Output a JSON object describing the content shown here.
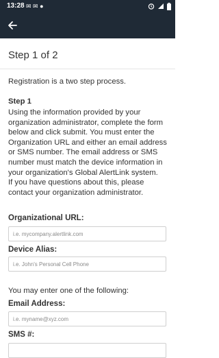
{
  "status_bar": {
    "time": "13:28",
    "notification_icons": "✉ ✉ ●"
  },
  "app_bar": {
    "back_icon": "arrow-left-icon"
  },
  "page": {
    "step_title": "Step 1 of 2",
    "intro": "Registration is a two step process.",
    "step1_heading": "Step 1",
    "instructions_lines": [
      "Using the information provided by your",
      "organization administrator, complete the form",
      "below and click submit. You must enter the",
      "Organization URL and either an email address",
      "or SMS number. The email address or SMS",
      "number must match the device information in",
      "your organization's Global AlertLink system.",
      "If you have questions about this, please",
      "contact your organization administrator."
    ]
  },
  "form": {
    "org_url_label": "Organizational URL:",
    "org_url_placeholder": "i.e. mycompany.alertlink.com",
    "device_alias_label": "Device Alias:",
    "device_alias_placeholder": "i.e. John's Personal Cell Phone",
    "enter_one": "You may enter one of the following:",
    "email_label": "Email Address:",
    "email_placeholder": "i.e. myname@xyz.com",
    "sms_label": "SMS #:"
  }
}
